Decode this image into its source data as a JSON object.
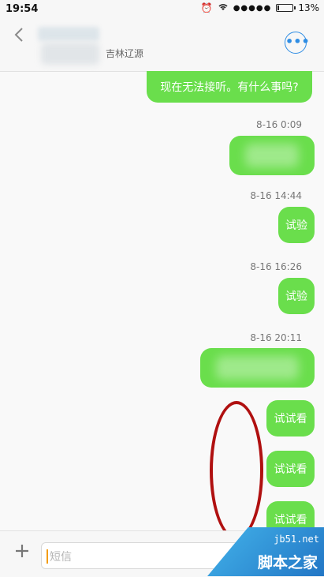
{
  "status_bar": {
    "time": "19:54",
    "signal": "●●●●●",
    "battery_percent": "13%",
    "battery_level": 0.13
  },
  "header": {
    "back_icon": "chevron-left-icon",
    "subtitle": "吉林辽源",
    "more_icon": "ellipsis-icon"
  },
  "messages": {
    "first_text": "现在无法接听。有什么事吗?",
    "ts1": "8-16 0:09",
    "ts2": "8-16 14:44",
    "text2": "试验",
    "ts3": "8-16 16:26",
    "text3": "试验",
    "ts4": "8-16 20:11",
    "text5": "试试看",
    "text6": "试试看",
    "text7": "试试看"
  },
  "composer": {
    "plus_icon": "plus-icon",
    "placeholder": "短信"
  },
  "watermark": {
    "top": "jb51.net",
    "bottom": "脚本之家"
  },
  "colors": {
    "bubble": "#6ade4c",
    "accent": "#2f8de4",
    "ring": "#b01010"
  }
}
